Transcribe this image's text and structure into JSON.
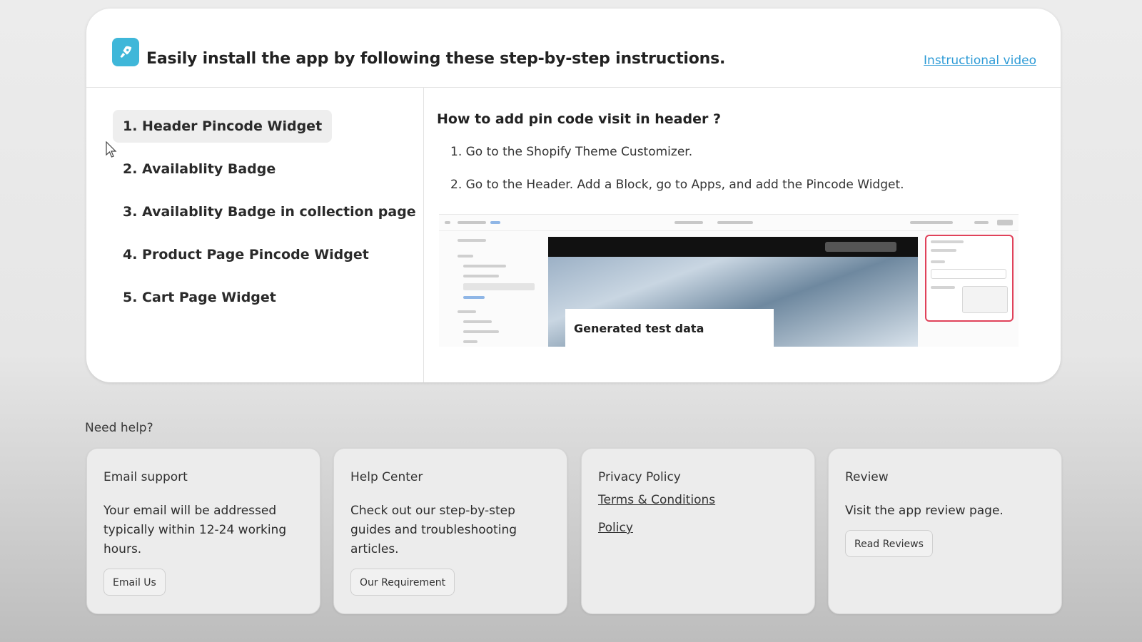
{
  "install": {
    "title": "Easily install the app by following these step-by-step instructions.",
    "video_link": "Instructional video",
    "icon": "rocket-icon",
    "accent": "#3fb7d9",
    "steps": [
      "1. Header Pincode Widget",
      "2. Availablity Badge",
      "3. Availablity Badge in collection page",
      "4. Product Page Pincode Widget",
      "5. Cart Page Widget"
    ],
    "active_step": 0,
    "content": {
      "title": "How to add pin code visit in header ?",
      "instructions": [
        "1. Go to the Shopify Theme Customizer.",
        "2. Go to the Header. Add a Block, go to Apps, and add the Pincode Widget."
      ],
      "screenshot_overlay": "Generated test data"
    }
  },
  "help": {
    "heading": "Need help?",
    "cards": {
      "email": {
        "title": "Email support",
        "desc": "Your email will be addressed typically within 12-24 working hours.",
        "button": "Email Us"
      },
      "help_center": {
        "title": "Help Center",
        "desc": "Check out our step-by-step guides and troubleshooting articles.",
        "button": "Our Requirement"
      },
      "privacy": {
        "title": "Privacy Policy",
        "link1": "Terms & Conditions",
        "link2": "Policy"
      },
      "review": {
        "title": "Review",
        "desc": "Visit the app review page.",
        "button": "Read Reviews"
      }
    }
  }
}
